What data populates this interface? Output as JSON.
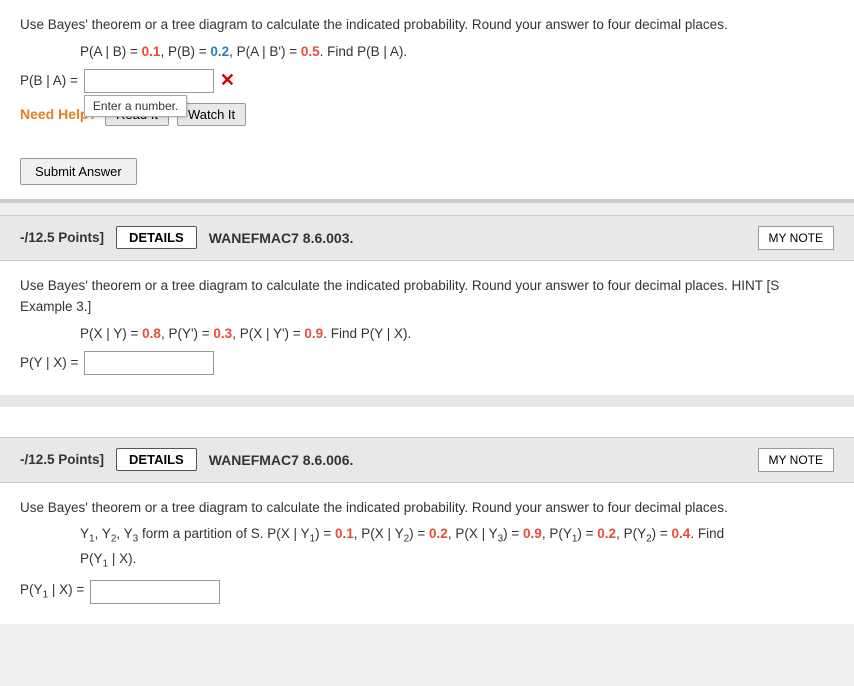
{
  "problem1": {
    "instruction": "Use Bayes' theorem or a tree diagram to calculate the indicated probability. Round your answer to four decimal places.",
    "given": "P(A | B) = 0.1, P(B) = 0.2, P(A | B') = 0.5. Find P(B | A).",
    "given_parts": [
      {
        "label": "P(A | B) = ",
        "value": "0.1",
        "color": "red"
      },
      {
        "label": ", P(B) = ",
        "value": "0.2",
        "color": "blue"
      },
      {
        "label": ", P(A | B') = ",
        "value": "0.5",
        "color": "red"
      },
      {
        "label": ". Find P(B | A).",
        "value": "",
        "color": "none"
      }
    ],
    "answer_label": "P(B | A) = ",
    "tooltip_text": "Enter a number.",
    "need_help_label": "Need Help?",
    "read_it_label": "Read It",
    "watch_it_label": "Watch It",
    "submit_label": "Submit Answer"
  },
  "problem2": {
    "points_label": "-/12.5 Points]",
    "details_label": "DETAILS",
    "problem_id": "WANEFMAC7 8.6.003.",
    "my_notes_label": "MY NOTE",
    "instruction": "Use Bayes' theorem or a tree diagram to calculate the indicated probability. Round your answer to four decimal places. HINT [S Example 3.]",
    "given": "P(X | Y) = 0.8, P(Y') = 0.3, P(X | Y') = 0.9. Find P(Y | X).",
    "given_parts": [
      {
        "label": "P(X | Y) = ",
        "value": "0.8",
        "color": "red"
      },
      {
        "label": ", P(Y') = ",
        "value": "0.3",
        "color": "red"
      },
      {
        "label": ", P(X | Y') = ",
        "value": "0.9",
        "color": "red"
      },
      {
        "label": ". Find P(Y | X).",
        "value": "",
        "color": "none"
      }
    ],
    "answer_label": "P(Y | X) = "
  },
  "problem3": {
    "points_label": "-/12.5 Points]",
    "details_label": "DETAILS",
    "problem_id": "WANEFMAC7 8.6.006.",
    "my_notes_label": "MY NOTE",
    "instruction": "Use Bayes' theorem or a tree diagram to calculate the indicated probability. Round your answer to four decimal places.",
    "given_line1": "Y₁, Y₂, Y₃ form a partition of S. P(X | Y₁) = 0.1, P(X | Y₂) = 0.2, P(X | Y₃) = 0.9, P(Y₁) = 0.2, P(Y₂) = 0.4. Find",
    "given_line2": "P(Y₁ | X).",
    "answer_label": "P(Y₁ | X) = "
  },
  "colors": {
    "red": "#e74c3c",
    "blue": "#2980b9",
    "orange": "#e67e22"
  }
}
